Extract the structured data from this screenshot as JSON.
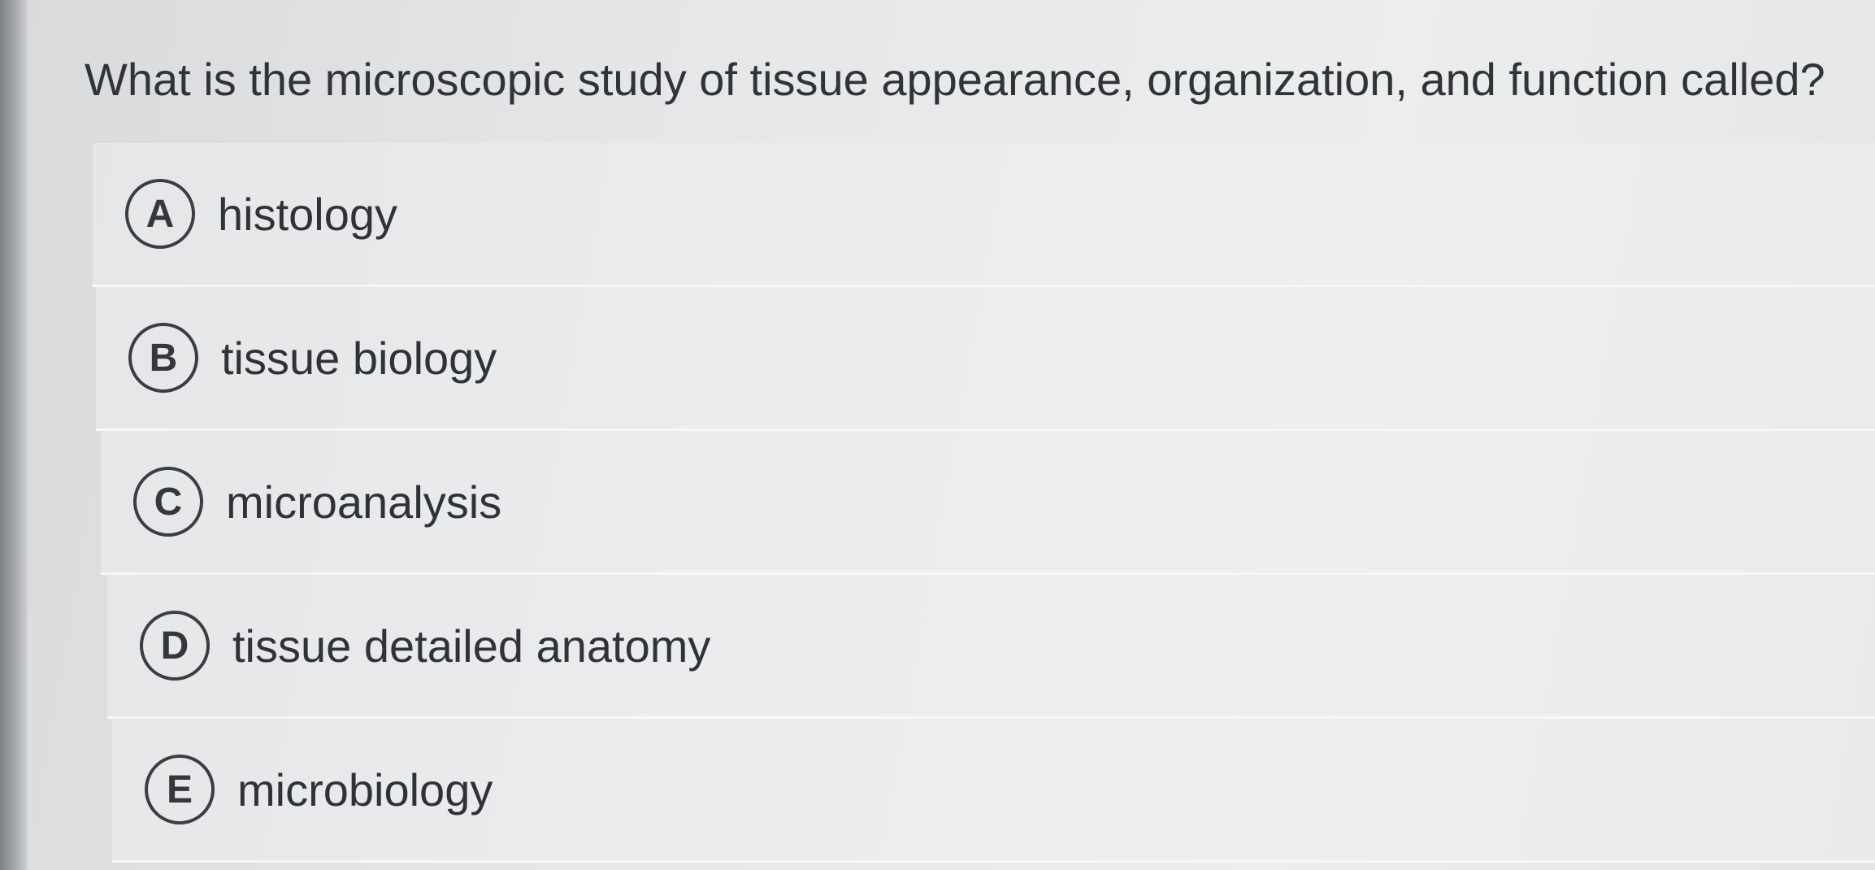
{
  "question": {
    "text": "What is the microscopic study of tissue appearance, organization, and function called?"
  },
  "options": [
    {
      "letter": "A",
      "label": "histology"
    },
    {
      "letter": "B",
      "label": "tissue biology"
    },
    {
      "letter": "C",
      "label": "microanalysis"
    },
    {
      "letter": "D",
      "label": "tissue detailed anatomy"
    },
    {
      "letter": "E",
      "label": "microbiology"
    }
  ]
}
